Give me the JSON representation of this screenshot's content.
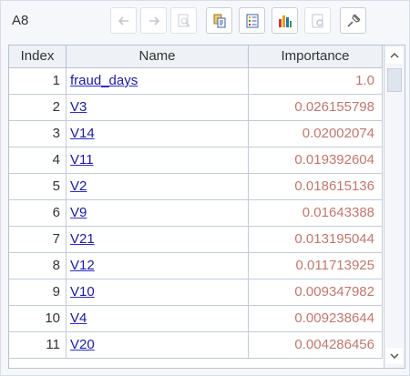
{
  "toolbar": {
    "cell_ref": "A8",
    "buttons": [
      {
        "icon": "arrow-left-icon",
        "enabled": false
      },
      {
        "icon": "arrow-right-icon",
        "enabled": false
      },
      {
        "icon": "magnifier-icon",
        "enabled": false
      },
      {
        "icon": "copy-icon",
        "enabled": true
      },
      {
        "icon": "list-icon",
        "enabled": true
      },
      {
        "icon": "bar-chart-icon",
        "enabled": true
      },
      {
        "icon": "page-settings-icon",
        "enabled": false
      },
      {
        "icon": "pin-icon",
        "enabled": true
      }
    ]
  },
  "table": {
    "columns": [
      "Index",
      "Name",
      "Importance"
    ],
    "rows": [
      {
        "index": "1",
        "name": "fraud_days",
        "importance": "1.0"
      },
      {
        "index": "2",
        "name": "V3",
        "importance": "0.026155798"
      },
      {
        "index": "3",
        "name": "V14",
        "importance": "0.02002074"
      },
      {
        "index": "4",
        "name": "V11",
        "importance": "0.019392604"
      },
      {
        "index": "5",
        "name": "V2",
        "importance": "0.018615136"
      },
      {
        "index": "6",
        "name": "V9",
        "importance": "0.01643388"
      },
      {
        "index": "7",
        "name": "V21",
        "importance": "0.013195044"
      },
      {
        "index": "8",
        "name": "V12",
        "importance": "0.011713925"
      },
      {
        "index": "9",
        "name": "V10",
        "importance": "0.009347982"
      },
      {
        "index": "10",
        "name": "V4",
        "importance": "0.009238644"
      },
      {
        "index": "11",
        "name": "V20",
        "importance": "0.004286456"
      }
    ]
  },
  "colors": {
    "importance_text": "#c0786e",
    "name_link": "#1b1b9e",
    "header_bg": "#eef1f6"
  }
}
